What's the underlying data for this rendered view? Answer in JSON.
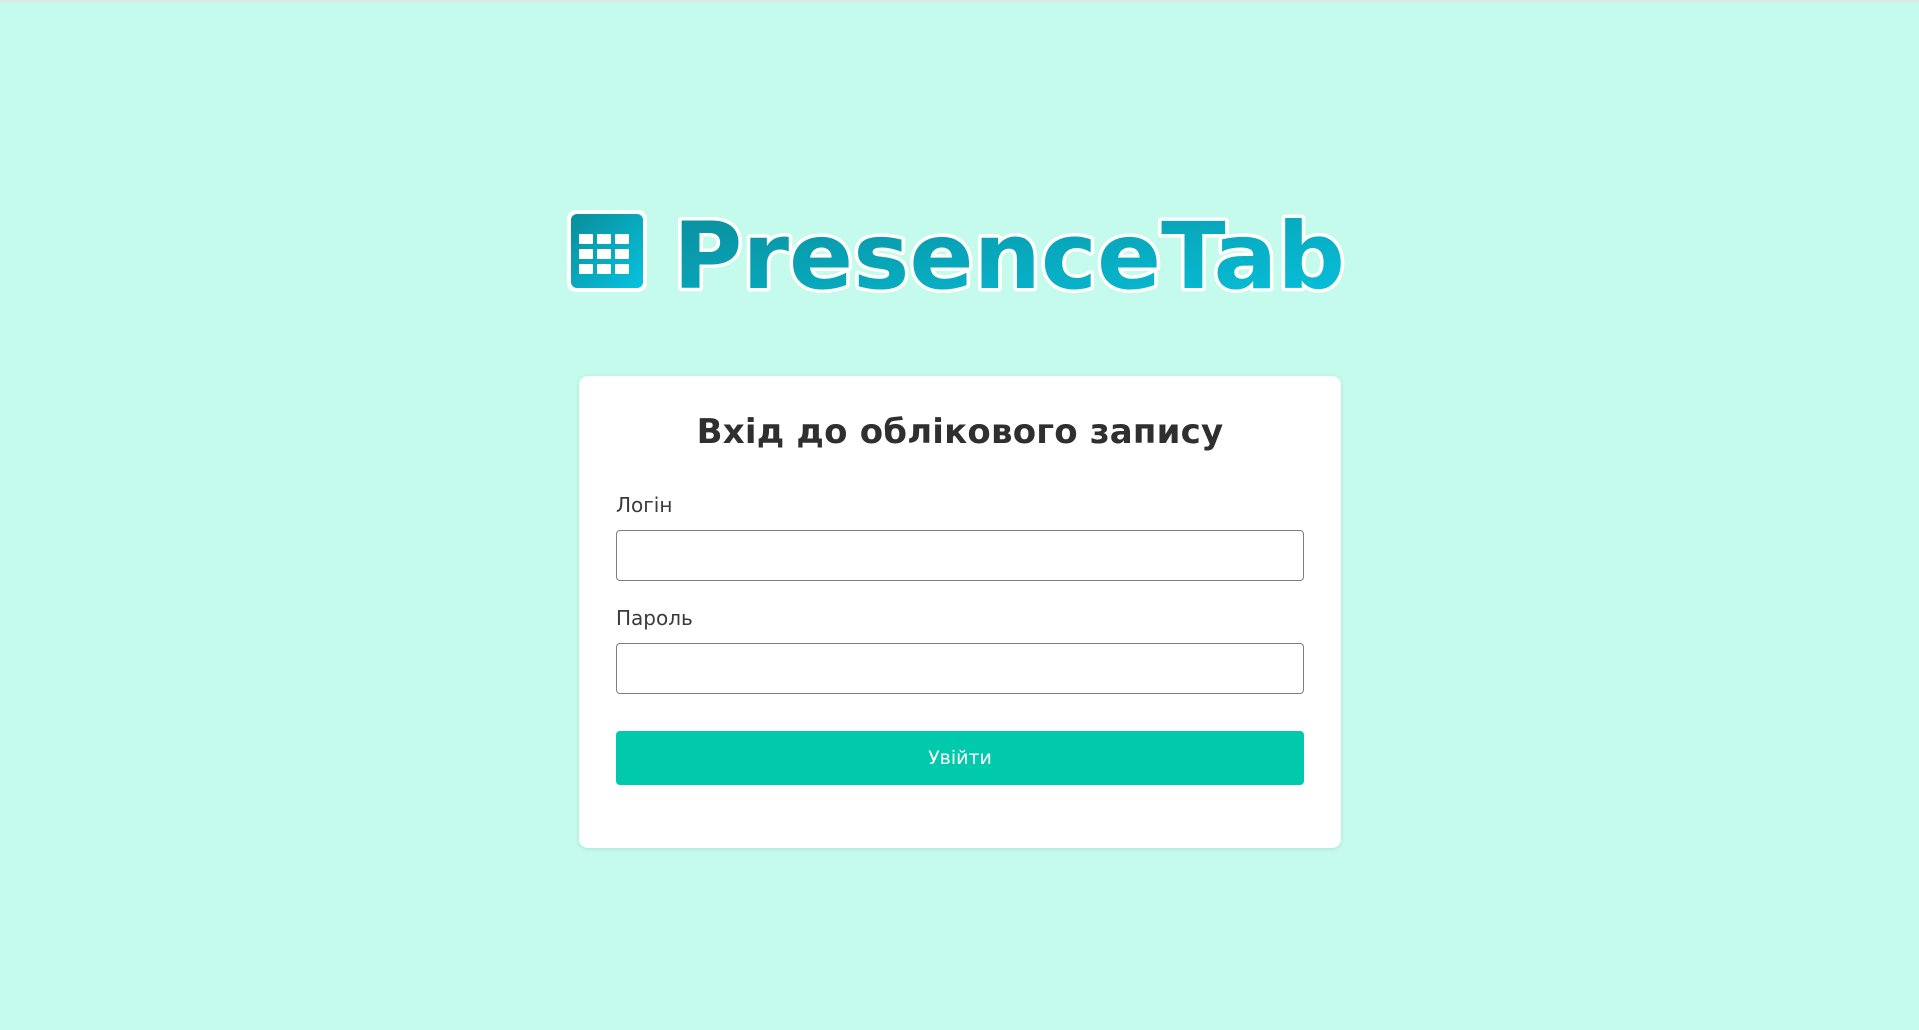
{
  "brand": {
    "name": "PresenceTab",
    "logo_icon": "calendar-grid-icon",
    "colors": {
      "gradient_start": "#0a8d9a",
      "gradient_end": "#06c3df"
    }
  },
  "login_form": {
    "title": "Вхід до облікового запису",
    "login_label": "Логін",
    "login_value": "",
    "password_label": "Пароль",
    "password_value": "",
    "submit_label": "Увійти"
  },
  "colors": {
    "background": "#c4fbec",
    "card": "#ffffff",
    "button": "#01c9ab",
    "title_text": "#2f2f2f"
  }
}
